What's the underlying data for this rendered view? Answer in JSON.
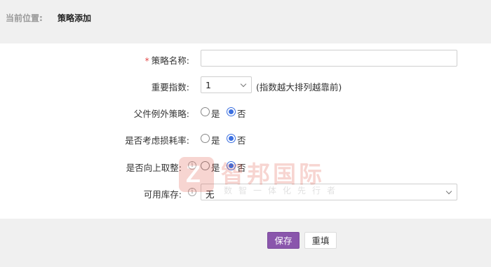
{
  "breadcrumb": {
    "prefix": "当前位置:",
    "current": "策略添加"
  },
  "form": {
    "strategy_name": {
      "label": "策略名称:",
      "required_mark": "*",
      "value": "",
      "placeholder": ""
    },
    "importance": {
      "label": "重要指数:",
      "selected": "1",
      "hint": "(指数越大排列越靠前)"
    },
    "parent_exception": {
      "label": "父件例外策略:",
      "options": [
        "是",
        "否"
      ],
      "selected": "否"
    },
    "consider_loss": {
      "label": "是否考虑损耗率:",
      "options": [
        "是",
        "否"
      ],
      "selected": "否"
    },
    "round_up": {
      "label": "是否向上取整:",
      "info_icon": "info-icon",
      "options": [
        "是",
        "否"
      ],
      "selected": "否"
    },
    "available_stock": {
      "label": "可用库存:",
      "info_icon": "info-icon",
      "selected": "无"
    }
  },
  "watermark": {
    "mark": "Z",
    "name": "智邦国际",
    "tagline": "数智一体化先行者"
  },
  "actions": {
    "save_label": "保存",
    "reset_label": "重填"
  },
  "colors": {
    "primary_button": "#8a56ac",
    "radio_checked": "#3b6fe0",
    "required": "#e34b4b",
    "watermark": "#dd4433"
  }
}
